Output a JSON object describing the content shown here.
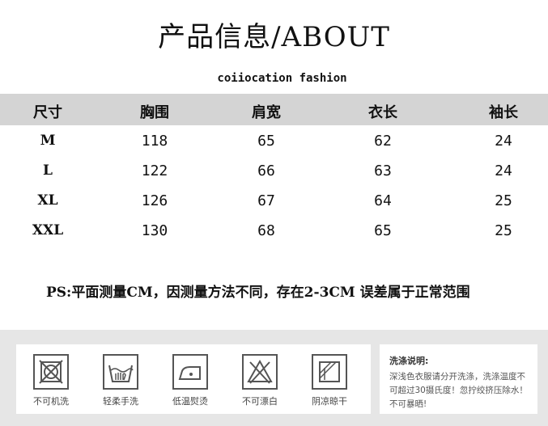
{
  "title": "产品信息/ABOUT",
  "brand": "coiiocation fashion",
  "table": {
    "headers": [
      "尺寸",
      "胸围",
      "肩宽",
      "衣长",
      "袖长"
    ],
    "rows": [
      [
        "M",
        "118",
        "65",
        "62",
        "24"
      ],
      [
        "L",
        "122",
        "66",
        "63",
        "24"
      ],
      [
        "XL",
        "126",
        "67",
        "64",
        "25"
      ],
      [
        "XXL",
        "130",
        "68",
        "65",
        "25"
      ]
    ]
  },
  "note": "PS:平面测量CM，因测量方法不同，存在2-3CM 误差属于正常范围",
  "care": {
    "items": [
      {
        "icon": "no-machine-wash-icon",
        "label": "不可机洗"
      },
      {
        "icon": "gentle-hand-wash-icon",
        "label": "轻柔手洗"
      },
      {
        "icon": "low-temp-iron-icon",
        "label": "低温熨烫"
      },
      {
        "icon": "no-bleach-icon",
        "label": "不可漂白"
      },
      {
        "icon": "shade-dry-icon",
        "label": "阴凉晾干"
      }
    ],
    "wash_title": "洗涤说明:",
    "wash_text": "深浅色衣服请分开洗涤，洗涤温度不可超过30摄氏度！忽拧绞挤压除水！不可暴晒!"
  }
}
